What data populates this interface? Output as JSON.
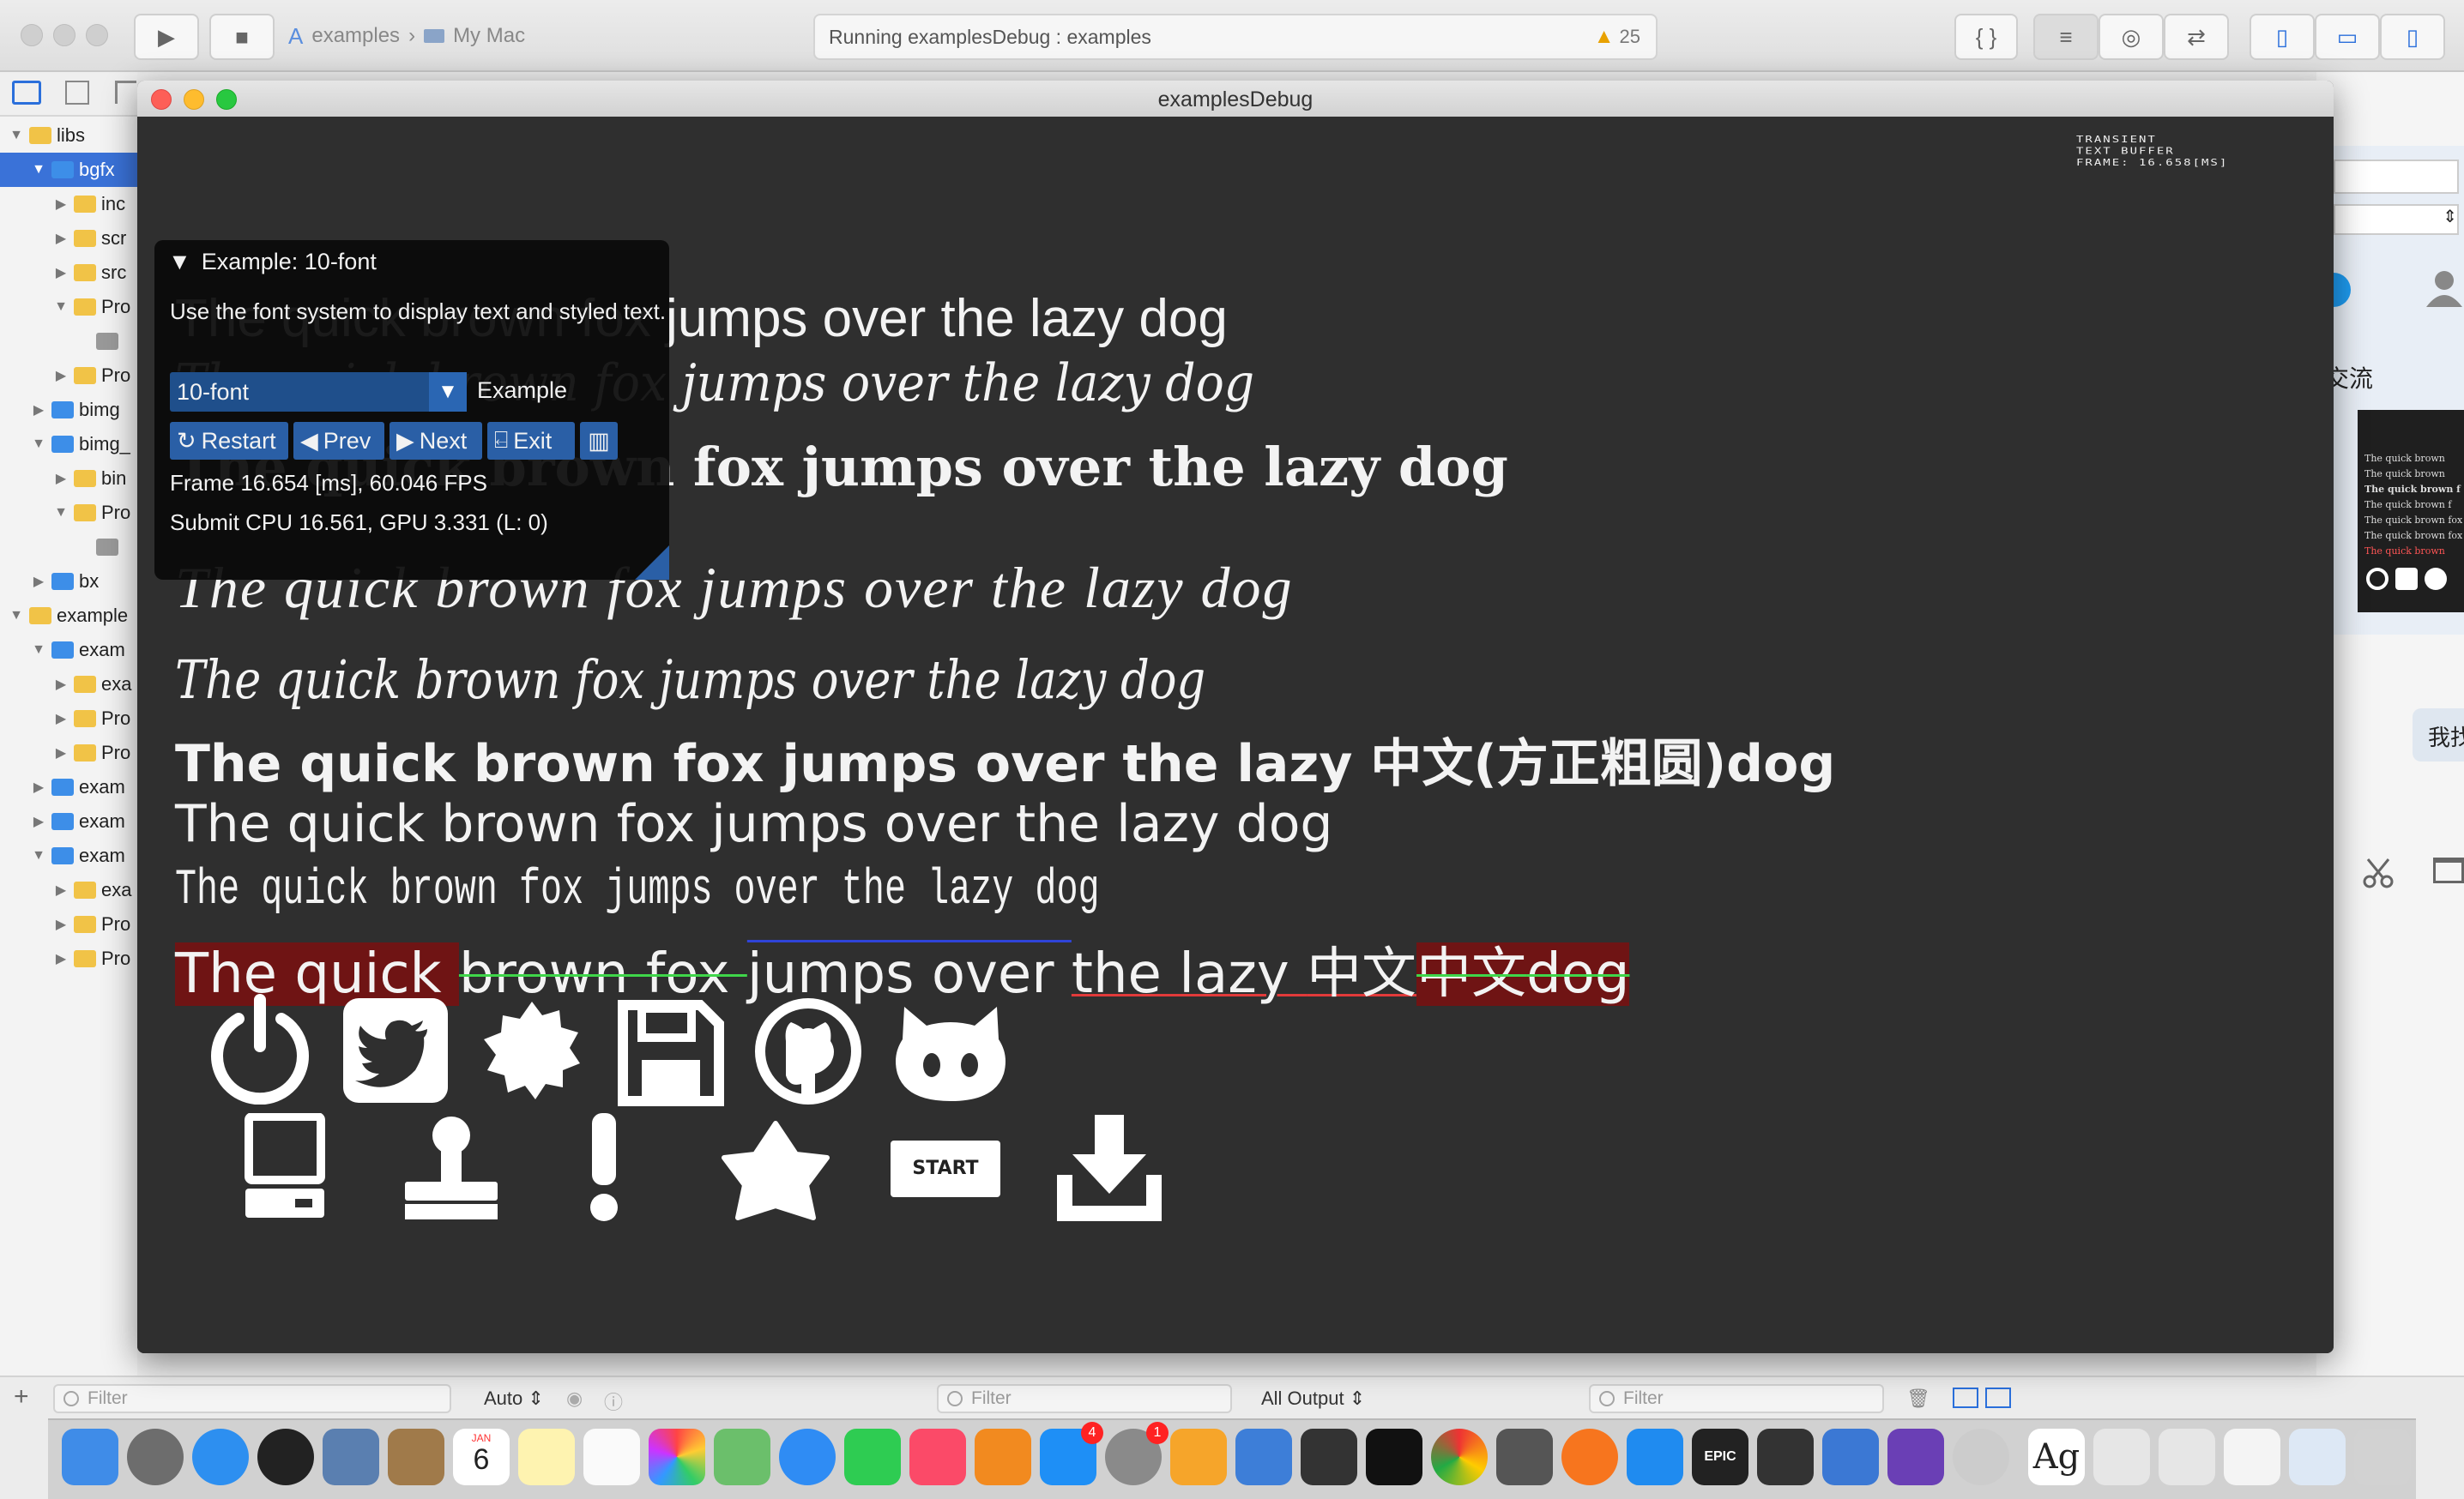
{
  "xcode": {
    "scheme_project": "examples",
    "scheme_device": "My Mac",
    "activity": "Running examplesDebug : examples",
    "warning_count": "25",
    "braces_label": "{ }"
  },
  "navigator": {
    "rows": [
      {
        "label": "libs",
        "kind": "folder",
        "indent": 0,
        "open": true
      },
      {
        "label": "bgfx",
        "kind": "proj",
        "indent": 1,
        "open": true,
        "selected": true
      },
      {
        "label": "inc",
        "kind": "folder",
        "indent": 2,
        "open": false
      },
      {
        "label": "scr",
        "kind": "folder",
        "indent": 2,
        "open": false
      },
      {
        "label": "src",
        "kind": "folder",
        "indent": 2,
        "open": false
      },
      {
        "label": "Pro",
        "kind": "folder",
        "indent": 2,
        "open": true
      },
      {
        "label": "",
        "kind": "lib",
        "indent": 3,
        "open": null
      },
      {
        "label": "Pro",
        "kind": "folder",
        "indent": 2,
        "open": false
      },
      {
        "label": "bimg",
        "kind": "proj",
        "indent": 1,
        "open": false
      },
      {
        "label": "bimg_",
        "kind": "proj",
        "indent": 1,
        "open": true
      },
      {
        "label": "bin",
        "kind": "folder",
        "indent": 2,
        "open": false
      },
      {
        "label": "Pro",
        "kind": "folder",
        "indent": 2,
        "open": true
      },
      {
        "label": "",
        "kind": "lib",
        "indent": 3,
        "open": null
      },
      {
        "label": "bx",
        "kind": "proj",
        "indent": 1,
        "open": false
      },
      {
        "label": "example",
        "kind": "folder",
        "indent": 0,
        "open": true
      },
      {
        "label": "exam",
        "kind": "proj",
        "indent": 1,
        "open": true
      },
      {
        "label": "exa",
        "kind": "folder",
        "indent": 2,
        "open": false
      },
      {
        "label": "Pro",
        "kind": "folder",
        "indent": 2,
        "open": false
      },
      {
        "label": "Pro",
        "kind": "folder",
        "indent": 2,
        "open": false
      },
      {
        "label": "exam",
        "kind": "proj",
        "indent": 1,
        "open": false
      },
      {
        "label": "exam",
        "kind": "proj",
        "indent": 1,
        "open": false
      },
      {
        "label": "exam",
        "kind": "proj",
        "indent": 1,
        "open": true
      },
      {
        "label": "exa",
        "kind": "folder",
        "indent": 2,
        "open": false
      },
      {
        "label": "Pro",
        "kind": "folder",
        "indent": 2,
        "open": false
      },
      {
        "label": "Pro",
        "kind": "folder",
        "indent": 2,
        "open": false
      }
    ]
  },
  "right": {
    "chat_label": "交流",
    "bubble_text": "我找",
    "thumb_lines": [
      "The quick brown",
      "The quick brown",
      "The quick brown f",
      "The quick brown f",
      "The quick brown fox ju",
      "The quick brown fox jun",
      "The quick brown"
    ]
  },
  "debugbar": {
    "filter_placeholder": "Filter",
    "auto_label": "Auto",
    "output_label": "All Output"
  },
  "app": {
    "window_title": "examplesDebug",
    "debug_text": [
      "TRANSIENT",
      "TEXT BUFFER",
      "FRAME: 16.658[MS]"
    ],
    "lines": {
      "l1": "The quick brown fox jumps over the lazy  dog",
      "l2": "The quick brown fox jumps over the lazy  dog",
      "l3": "The quick brown fox jumps over the lazy  dog",
      "l4": "The quick brown fox jumps over the lazy  dog",
      "l5": "The quick brown fox jumps over the lazy  dog",
      "l6": "The quick brown fox jumps over the lazy  中文(方正粗圆)dog",
      "l7": "The quick brown fox jumps over the lazy  dog",
      "l8": "The quick brown fox jumps over the lazy dog",
      "l9": {
        "s1": "The quick ",
        "s2": "brown fox ",
        "s3": "jumps over ",
        "s4": "the lazy ",
        "s5": "中文",
        "s6": "中文",
        "s7": "dog"
      }
    },
    "start_label": "START",
    "imgui": {
      "title": "Example: 10-font",
      "description": "Use the font system to display text and styled text.",
      "combo_value": "10-font",
      "combo_label": "Example",
      "btn_restart": "Restart",
      "btn_prev": "Prev",
      "btn_next": "Next",
      "btn_exit": "Exit",
      "frame": "Frame 16.654 [ms], 60.046 FPS",
      "submit": "Submit CPU 16.561, GPU 3.331 (L: 0)"
    }
  },
  "dock": {
    "calendar_month": "JAN",
    "calendar_day": "6",
    "appstore_badge": "4",
    "settings_badge": "1",
    "epic_label": "EPIC",
    "ag_label": "Ag"
  }
}
